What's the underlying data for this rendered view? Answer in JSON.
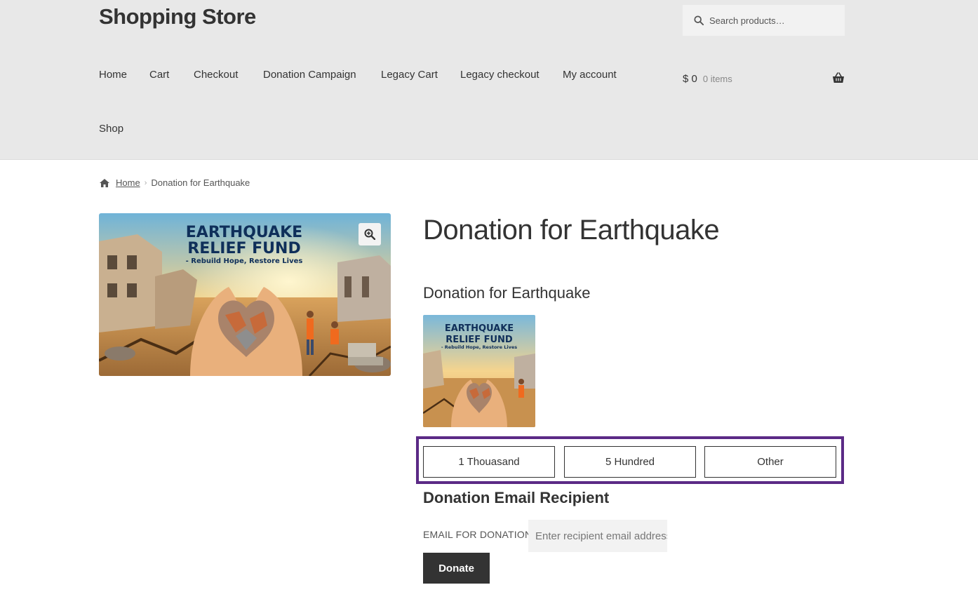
{
  "site": {
    "title": "Shopping Store"
  },
  "search": {
    "placeholder": "Search products…"
  },
  "nav": {
    "items": [
      {
        "label": "Home"
      },
      {
        "label": "Cart"
      },
      {
        "label": "Checkout"
      },
      {
        "label": "Donation Campaign"
      },
      {
        "label": "Legacy Cart"
      },
      {
        "label": "Legacy checkout"
      },
      {
        "label": "My account"
      },
      {
        "label": "Shop"
      }
    ]
  },
  "cart": {
    "amount": "$ 0",
    "count": "0 items"
  },
  "breadcrumb": {
    "home": "Home",
    "current": "Donation for Earthquake"
  },
  "image": {
    "line1": "EARTHQUAKE",
    "line2": "RELIEF FUND",
    "line3": "- Rebuild Hope, Restore Lives"
  },
  "product": {
    "title": "Donation for Earthquake",
    "subtitle": "Donation for Earthquake"
  },
  "amounts": {
    "options": [
      {
        "label": "1 Thouasand"
      },
      {
        "label": "5 Hundred"
      },
      {
        "label": "Other"
      }
    ]
  },
  "recipient": {
    "heading": "Donation Email Recipient",
    "label": "EMAIL FOR DONATION",
    "placeholder": "Enter recipient email address"
  },
  "actions": {
    "donate_label": "Donate"
  },
  "colors": {
    "header_bg": "#e8e8e8",
    "highlight_border": "#5b2a86",
    "donate_bg": "#333333"
  }
}
